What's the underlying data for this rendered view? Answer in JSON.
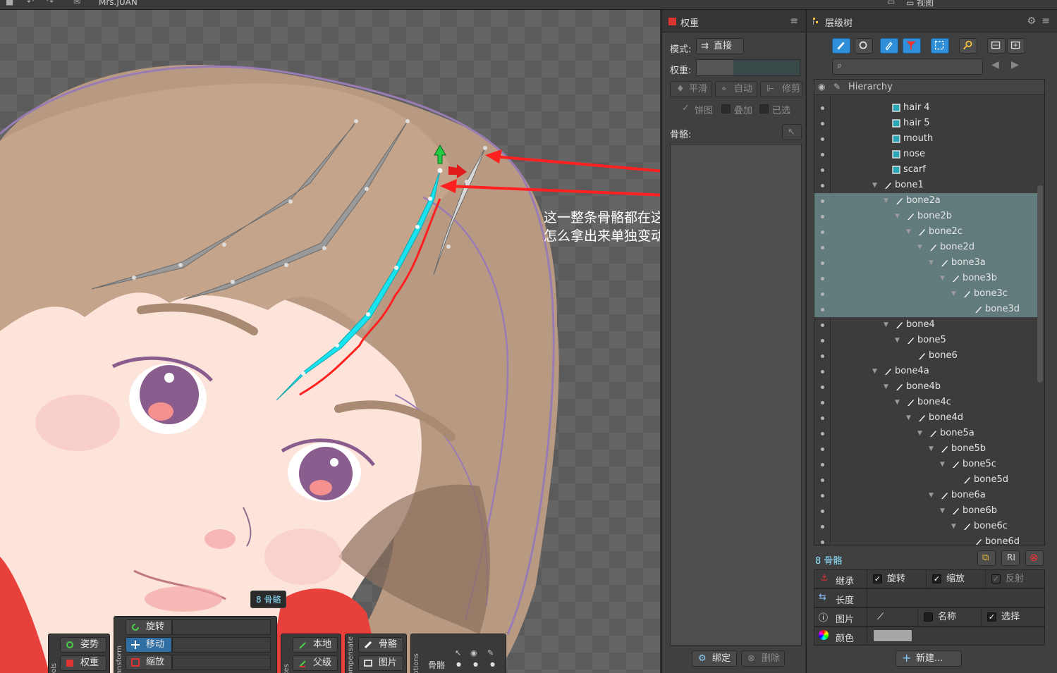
{
  "topbar": {
    "project_name": "Mrs.JUAN",
    "view_label": "视图"
  },
  "annotation": {
    "line1": "这一整条骨骼都在这个右边父级里面了，",
    "line2": "怎么拿出来单独变动的意思"
  },
  "viewport": {
    "bone_count_tooltip": "8 骨骼"
  },
  "tools": {
    "label": "Tools",
    "pose": "姿势",
    "weights": "权重",
    "transform_label": "Transform",
    "rotate": "旋转",
    "translate": "移动",
    "scale": "缩放",
    "axes_label": "Axes",
    "local": "本地",
    "parent": "父级",
    "compensate_label": "Compensate",
    "bones": "骨骼",
    "images": "图片",
    "options_label": "Options",
    "opt_bones": "骨骼",
    "opt_images": "图片"
  },
  "weights_panel": {
    "title": "权重",
    "mode_label": "模式:",
    "mode_value": "直接",
    "weight_label": "权重:",
    "smooth": "平滑",
    "auto": "自动",
    "prune": "修剪",
    "overlay_pie": "饼图",
    "overlay_add": "叠加",
    "overlay_selected": "已选",
    "bones_label": "骨骼:",
    "bind": "绑定",
    "remove": "删除"
  },
  "tree_panel": {
    "title": "层级树",
    "search_placeholder": "",
    "header": "Hierarchy",
    "rows": [
      {
        "name": "hair 4",
        "type": "slot",
        "depth": 0,
        "sel": false,
        "tri": false
      },
      {
        "name": "hair 5",
        "type": "slot",
        "depth": 0,
        "sel": false,
        "tri": false
      },
      {
        "name": "mouth",
        "type": "slot",
        "depth": 0,
        "sel": false,
        "tri": false
      },
      {
        "name": "nose",
        "type": "slot",
        "depth": 0,
        "sel": false,
        "tri": false
      },
      {
        "name": "scarf",
        "type": "slot",
        "depth": 0,
        "sel": false,
        "tri": false
      },
      {
        "name": "bone1",
        "type": "bone",
        "depth": 0,
        "sel": false,
        "tri": true
      },
      {
        "name": "bone2a",
        "type": "bone",
        "depth": 1,
        "sel": true,
        "tri": true
      },
      {
        "name": "bone2b",
        "type": "bone",
        "depth": 2,
        "sel": true,
        "tri": true
      },
      {
        "name": "bone2c",
        "type": "bone",
        "depth": 3,
        "sel": true,
        "tri": true
      },
      {
        "name": "bone2d",
        "type": "bone",
        "depth": 4,
        "sel": true,
        "tri": true
      },
      {
        "name": "bone3a",
        "type": "bone",
        "depth": 5,
        "sel": true,
        "tri": true
      },
      {
        "name": "bone3b",
        "type": "bone",
        "depth": 6,
        "sel": true,
        "tri": true
      },
      {
        "name": "bone3c",
        "type": "bone",
        "depth": 7,
        "sel": true,
        "tri": true
      },
      {
        "name": "bone3d",
        "type": "bone",
        "depth": 8,
        "sel": true,
        "tri": false
      },
      {
        "name": "bone4",
        "type": "bone",
        "depth": 1,
        "sel": false,
        "tri": true
      },
      {
        "name": "bone5",
        "type": "bone",
        "depth": 2,
        "sel": false,
        "tri": true
      },
      {
        "name": "bone6",
        "type": "bone",
        "depth": 3,
        "sel": false,
        "tri": false
      },
      {
        "name": "bone4a",
        "type": "bone",
        "depth": 0,
        "sel": false,
        "tri": true
      },
      {
        "name": "bone4b",
        "type": "bone",
        "depth": 1,
        "sel": false,
        "tri": true
      },
      {
        "name": "bone4c",
        "type": "bone",
        "depth": 2,
        "sel": false,
        "tri": true
      },
      {
        "name": "bone4d",
        "type": "bone",
        "depth": 3,
        "sel": false,
        "tri": true
      },
      {
        "name": "bone5a",
        "type": "bone",
        "depth": 4,
        "sel": false,
        "tri": true
      },
      {
        "name": "bone5b",
        "type": "bone",
        "depth": 5,
        "sel": false,
        "tri": true
      },
      {
        "name": "bone5c",
        "type": "bone",
        "depth": 6,
        "sel": false,
        "tri": true
      },
      {
        "name": "bone5d",
        "type": "bone",
        "depth": 7,
        "sel": false,
        "tri": false
      },
      {
        "name": "bone6a",
        "type": "bone",
        "depth": 5,
        "sel": false,
        "tri": true
      },
      {
        "name": "bone6b",
        "type": "bone",
        "depth": 6,
        "sel": false,
        "tri": true
      },
      {
        "name": "bone6c",
        "type": "bone",
        "depth": 7,
        "sel": false,
        "tri": true
      },
      {
        "name": "bone6d",
        "type": "bone",
        "depth": 8,
        "sel": false,
        "tri": false
      }
    ],
    "selection_count": "8 骨骼",
    "inherit_label": "继承",
    "inherit_rotation": "旋转",
    "inherit_scale": "缩放",
    "inherit_reflect": "反射",
    "length_label": "长度",
    "image_label": "图片",
    "name_label": "名称",
    "select_label": "选择",
    "color_label": "颜色",
    "new_button": "新建..."
  },
  "colors": {
    "accent_blue": "#2f8fd8",
    "selection": "#627b7d",
    "bone_cyan": "#19e3ee",
    "annotation_red": "#ff2020"
  }
}
